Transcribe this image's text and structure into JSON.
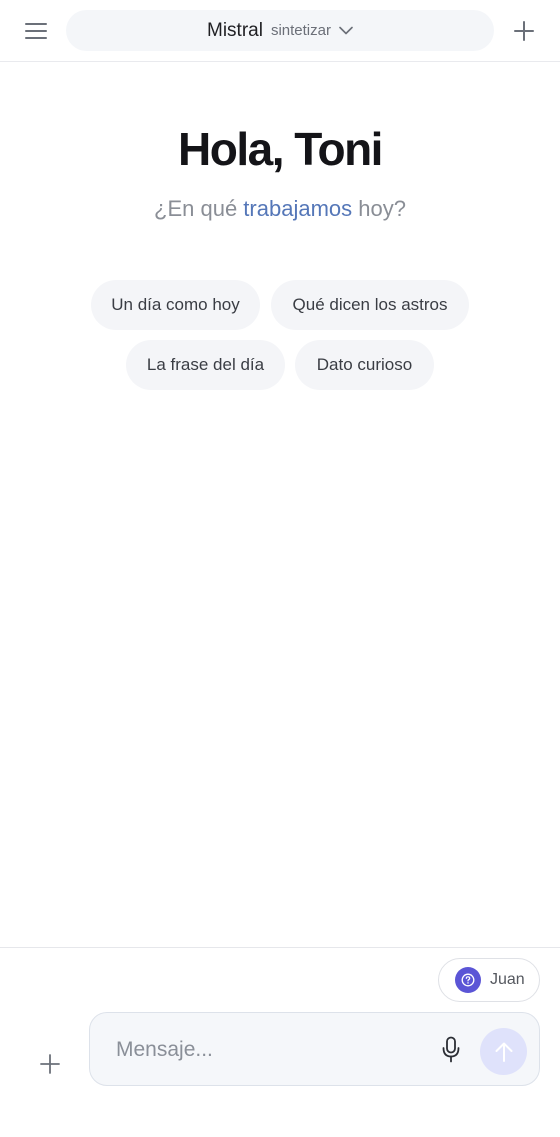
{
  "header": {
    "menu_icon": "hamburger-menu-icon",
    "model": {
      "name": "Mistral",
      "mode": "sintetizar",
      "dropdown_icon": "chevron-down-icon"
    },
    "new_chat_icon": "plus-icon"
  },
  "hero": {
    "greeting": "Hola, Toni",
    "subtitle_prefix": "¿En qué ",
    "subtitle_accent": "trabajamos",
    "subtitle_suffix": " hoy?"
  },
  "suggestions": [
    {
      "label": "Un día como hoy"
    },
    {
      "label": "Qué dicen los astros"
    },
    {
      "label": "La frase del día"
    },
    {
      "label": "Dato curioso"
    }
  ],
  "assistant": {
    "name": "Juan",
    "icon": "help-circle-icon"
  },
  "composer": {
    "placeholder": "Mensaje...",
    "attach_icon": "plus-icon",
    "mic_icon": "microphone-icon",
    "send_icon": "arrow-up-icon"
  },
  "colors": {
    "accent": "#5577b8",
    "assistant_avatar": "#5b55d6",
    "send_button": "#dfe2fb",
    "chip_bg": "#f4f5f8"
  }
}
